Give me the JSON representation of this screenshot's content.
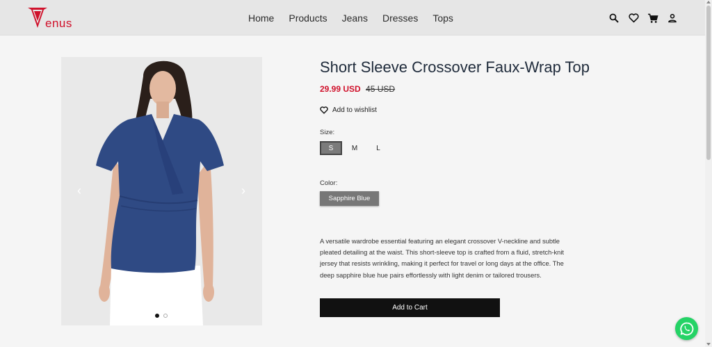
{
  "brand": {
    "logo_text": "enus",
    "color": "#d0112b"
  },
  "nav": {
    "items": [
      "Home",
      "Products",
      "Jeans",
      "Dresses",
      "Tops"
    ]
  },
  "header_icons": [
    "search-icon",
    "heart-icon",
    "cart-icon",
    "account-icon"
  ],
  "product": {
    "title": "Short Sleeve Crossover Faux-Wrap Top",
    "sale_price": "29.99 USD",
    "original_price": "45 USD",
    "wishlist_label": "Add to wishlist",
    "size_label": "Size:",
    "sizes": [
      "S",
      "M",
      "L"
    ],
    "selected_size": "S",
    "color_label": "Color:",
    "color_option": "Sapphire Blue",
    "description": "A versatile wardrobe essential featuring an elegant crossover V-neckline and subtle pleated detailing at the waist. This short-sleeve top is crafted from a fluid, stretch-knit jersey that resists wrinkling, making it perfect for travel or long days at the office. The deep sapphire blue hue pairs effortlessly with light denim or tailored trousers.",
    "cart_label": "Add to Cart"
  },
  "gallery": {
    "total_images": 2,
    "active_index": 0,
    "prev_symbol": "‹",
    "next_symbol": "›"
  },
  "colors": {
    "accent": "#d0112b",
    "top_color": "#2f4a84",
    "button_dark": "#111111",
    "whatsapp": "#25d366"
  }
}
